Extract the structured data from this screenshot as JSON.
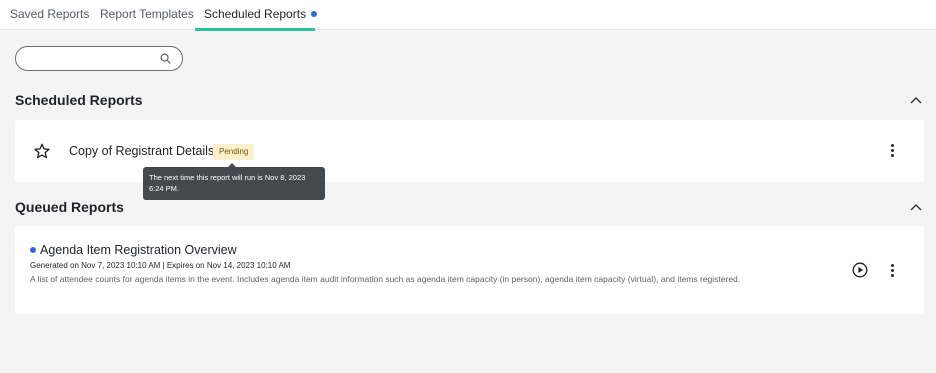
{
  "tabs": {
    "saved": "Saved Reports",
    "templates": "Report Templates",
    "scheduled": "Scheduled Reports"
  },
  "search": {
    "value": "",
    "placeholder": ""
  },
  "scheduled_section": {
    "title": "Scheduled Reports",
    "item": {
      "name": "Copy of Registrant Details",
      "status": "Pending",
      "tooltip": "The next time this report will run is Nov 8, 2023 6:24 PM."
    }
  },
  "queued_section": {
    "title": "Queued Reports",
    "item": {
      "name": "Agenda Item Registration Overview",
      "meta": "Generated on Nov 7, 2023 10:10 AM | Expires on Nov 14, 2023 10:10 AM",
      "description": "A list of attendee counts for agenda items in the event. Includes agenda item audit information such as agenda item capacity (in person), agenda item capacity (virtual), and items registered."
    }
  },
  "colors": {
    "active_tab_underline": "#2bc19a",
    "unread_dot": "#2b67e6",
    "pending_badge_bg": "#fcefcc",
    "tooltip_bg": "#44494f"
  },
  "icons": [
    "search-icon",
    "chevron-up-icon",
    "star-icon",
    "kebab-menu-icon",
    "play-icon"
  ]
}
